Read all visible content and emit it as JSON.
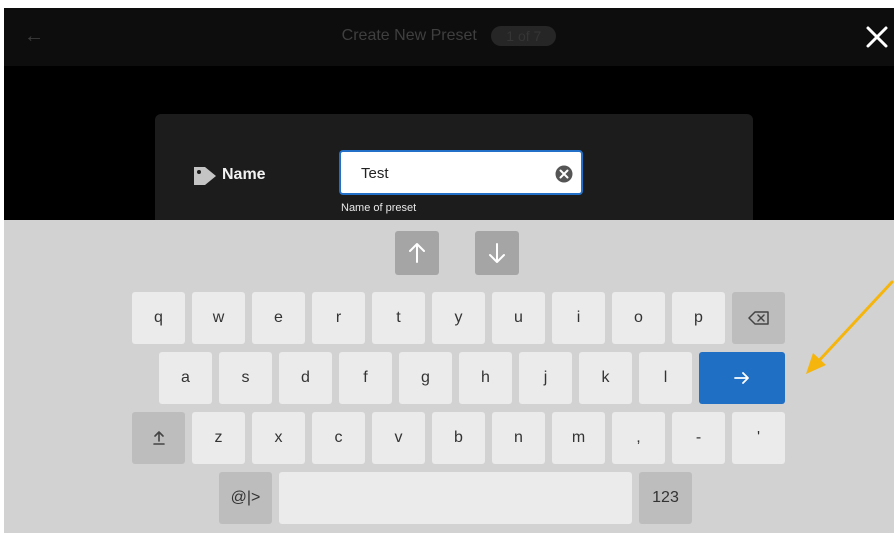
{
  "header": {
    "title": "Create New Preset",
    "step": "1 of 7"
  },
  "form": {
    "name_label": "Name",
    "name_value": "Test",
    "name_hint": "Name of preset"
  },
  "keyboard": {
    "row1": [
      "q",
      "w",
      "e",
      "r",
      "t",
      "y",
      "u",
      "i",
      "o",
      "p"
    ],
    "row2": [
      "a",
      "s",
      "d",
      "f",
      "g",
      "h",
      "j",
      "k",
      "l"
    ],
    "row3": [
      "z",
      "x",
      "c",
      "v",
      "b",
      "n",
      "m",
      ",",
      "-",
      "'"
    ],
    "symbols_label": "@|>",
    "numbers_label": "123"
  },
  "colors": {
    "enter_key": "#1f6fc5",
    "input_border": "#2370c8",
    "annotation_arrow": "#f5b50c"
  }
}
